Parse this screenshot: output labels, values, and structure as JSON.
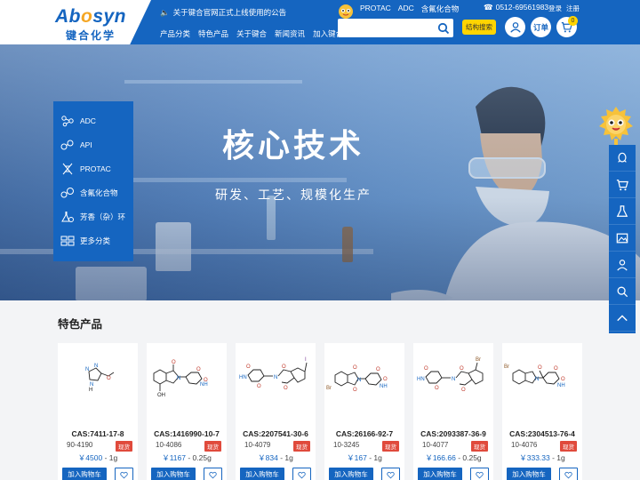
{
  "header": {
    "logo_text_a": "Ab",
    "logo_text_o": "o",
    "logo_text_b": "syn",
    "logo_cn": "键合化学",
    "notice": "关于键合官网正式上线使用的公告",
    "nav": [
      "产品分类",
      "特色产品",
      "关于键合",
      "新闻资讯",
      "加入键合"
    ],
    "quick_links": [
      "PROTAC",
      "ADC",
      "含氟化合物"
    ],
    "search_placeholder": "",
    "structure_search": "结构搜索",
    "phone": "0512-69561983",
    "login": "登录",
    "register": "注册",
    "order_label": "订单",
    "cart_count": "0"
  },
  "hero": {
    "title": "核心技术",
    "subtitle": "研发、工艺、规模化生产"
  },
  "category_menu": [
    {
      "label": "ADC",
      "icon": "molecule-icon"
    },
    {
      "label": "API",
      "icon": "molecule-icon"
    },
    {
      "label": "PROTAC",
      "icon": "dna-icon"
    },
    {
      "label": "含氟化合物",
      "icon": "molecule-icon"
    },
    {
      "label": "芳香（杂）环",
      "icon": "flask-icon"
    },
    {
      "label": "更多分类",
      "icon": "grid-icon"
    }
  ],
  "side_toolbar": [
    "qq-icon",
    "cart-icon",
    "flask-icon",
    "image-icon",
    "user-icon",
    "search-icon",
    "chevron-up-icon"
  ],
  "featured": {
    "title": "特色产品",
    "add_to_cart": "加入购物车",
    "products": [
      {
        "cas": "CAS:7411-17-8",
        "code": "90-4190",
        "stock": "现货",
        "price": "￥4500",
        "unit": " - 1g"
      },
      {
        "cas": "CAS:1416990-10-7",
        "code": "10-4086",
        "stock": "现货",
        "price": "￥1167",
        "unit": " - 0.25g"
      },
      {
        "cas": "CAS:2207541-30-6",
        "code": "10-4079",
        "stock": "现货",
        "price": "￥834",
        "unit": " - 1g"
      },
      {
        "cas": "CAS:26166-92-7",
        "code": "10-3245",
        "stock": "现货",
        "price": "￥167",
        "unit": " - 1g"
      },
      {
        "cas": "CAS:2093387-36-9",
        "code": "10-4077",
        "stock": "现货",
        "price": "￥166.66",
        "unit": " - 0.25g"
      },
      {
        "cas": "CAS:2304513-76-4",
        "code": "10-4076",
        "stock": "现货",
        "price": "￥333.33",
        "unit": " - 1g"
      }
    ]
  },
  "colors": {
    "primary": "#1565c0",
    "accent": "#ffd400",
    "stock_badge": "#e04a3c"
  }
}
